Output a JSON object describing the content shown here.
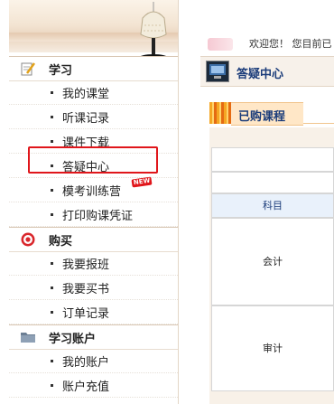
{
  "header": {
    "welcome_text": "欢迎您！ 您目前已"
  },
  "sidebar": {
    "groups": [
      {
        "label": "学习",
        "items": [
          "我的课堂",
          "听课记录",
          "课件下载",
          "答疑中心",
          "模考训练营",
          "打印购课凭证"
        ]
      },
      {
        "label": "购买",
        "items": [
          "我要报班",
          "我要买书",
          "订单记录"
        ]
      },
      {
        "label": "学习账户",
        "items": [
          "我的账户",
          "账户充值"
        ]
      }
    ],
    "new_badge": "NEW",
    "highlighted_item": "答疑中心"
  },
  "main": {
    "section_title": "答疑中心",
    "tab_title": "已购课程",
    "table": {
      "header": "科目",
      "rows": [
        "会计",
        "审计"
      ]
    }
  },
  "colors": {
    "accent_red": "#e0161b",
    "title_blue": "#1b3c7a",
    "tab_orange": "#f5a623"
  }
}
